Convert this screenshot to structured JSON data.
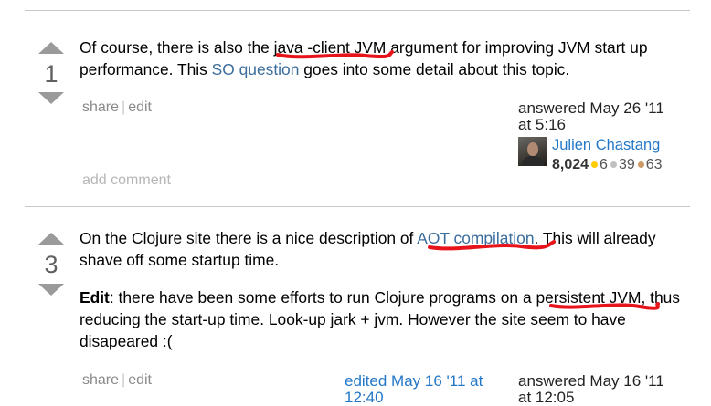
{
  "colors": {
    "link": "#3a6c9c",
    "user_link": "#2477c8",
    "annotation": "#e8141b",
    "bronze": "#cc9966",
    "silver": "#c0c0c0",
    "gold": "#ffcc00"
  },
  "answer1": {
    "score": "1",
    "text_a": "Of course, there is also the ",
    "text_code": "java -client JVM",
    "text_b": " argument for improving JVM start up performance. This ",
    "link_label": "SO question",
    "text_c": " goes into some detail about this topic.",
    "share_label": "share",
    "edit_label": "edit",
    "answered_label": "answered May 26 '11",
    "answered_time": "at 5:16",
    "user_name": "Julien Chastang",
    "rep": "8,024",
    "gold": "6",
    "silver": "39",
    "bronze": "63",
    "add_comment": "add comment"
  },
  "answer2": {
    "score": "3",
    "p1_a": "On the Clojure site there is a nice description of ",
    "p1_link": "AOT compilation",
    "p1_b": ". This will already shave off some startup time.",
    "p2_bold": "Edit",
    "p2_a": ": there have been some efforts to run Clojure programs on a ",
    "p2_link": "persistent JVM",
    "p2_b": ", thus reducing the start-up time. Look-up jark + jvm. However the site seem to have disapeared :(",
    "share_label": "share",
    "edit_label": "edit",
    "edited_label": "edited May 16 '11 at",
    "edited_time": "12:40",
    "answered_label": "answered May 16 '11",
    "answered_time": "at 12:05"
  },
  "icons": {
    "upvote": "arrow-up-icon",
    "downvote": "arrow-down-icon",
    "avatar": "user-avatar"
  }
}
